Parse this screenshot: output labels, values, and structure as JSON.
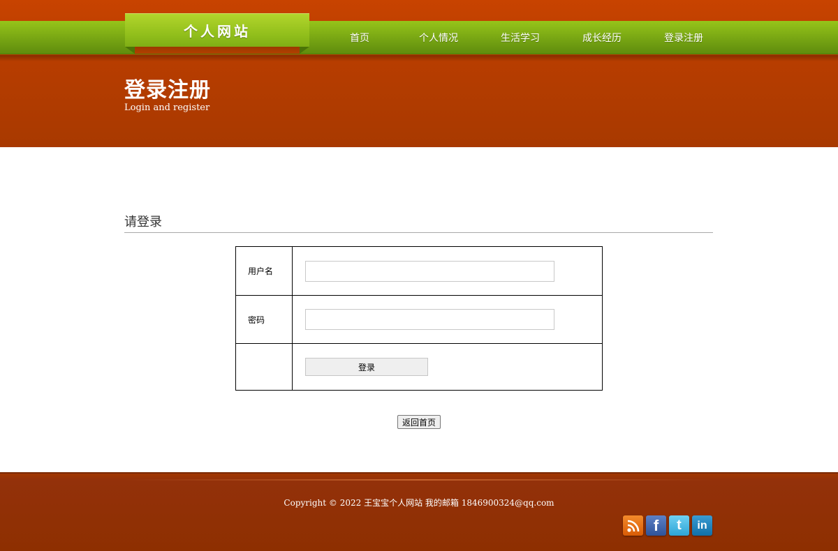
{
  "header": {
    "logo_text": "个人网站",
    "nav": [
      {
        "label": "首页"
      },
      {
        "label": "个人情况"
      },
      {
        "label": "生活学习"
      },
      {
        "label": "成长经历"
      },
      {
        "label": "登录注册"
      }
    ],
    "banner_title": "登录注册",
    "banner_subtitle": "Login and register"
  },
  "main": {
    "section_title": "请登录",
    "form": {
      "username_label": "用户名",
      "username_value": "",
      "password_label": "密码",
      "password_value": "",
      "login_button": "登录"
    },
    "back_button": "返回首页"
  },
  "footer": {
    "copyright": "Copyright © 2022 王宝宝个人网站 我的邮箱 1846900324@qq.com",
    "social": [
      {
        "icon": "rss-icon",
        "glyph": ""
      },
      {
        "icon": "facebook-icon",
        "glyph": "f"
      },
      {
        "icon": "twitter-icon",
        "glyph": "t"
      },
      {
        "icon": "linkedin-icon",
        "glyph": "in"
      }
    ]
  },
  "colors": {
    "header_orange": "#c24100",
    "nav_green": "#77a513",
    "footer_brown": "#8e2f00"
  }
}
